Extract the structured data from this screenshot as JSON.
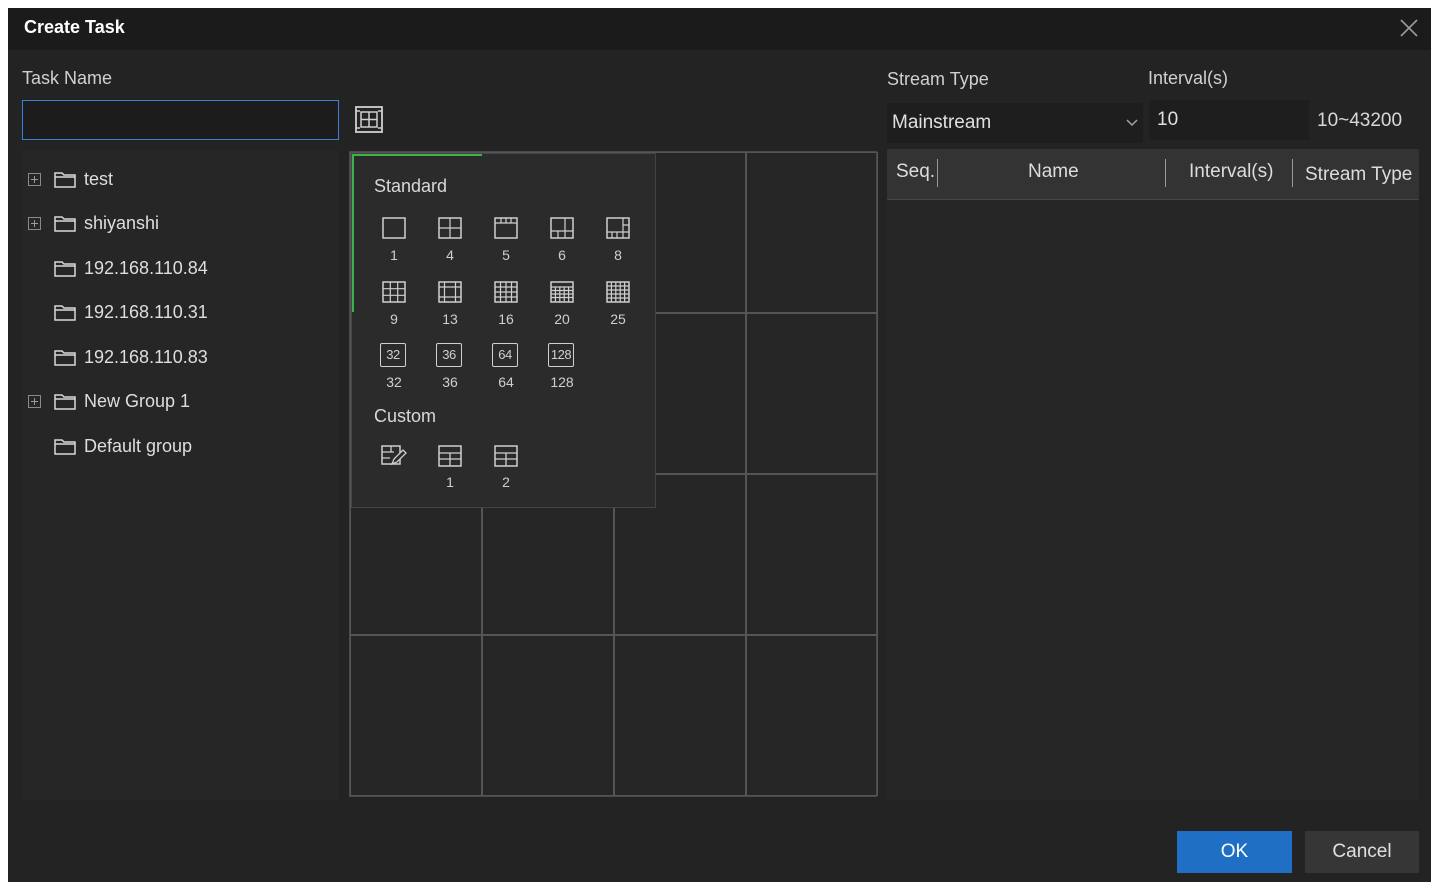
{
  "window": {
    "title": "Create Task"
  },
  "left": {
    "task_name_label": "Task Name",
    "task_name_value": "",
    "tree": [
      {
        "label": "test",
        "expandable": true
      },
      {
        "label": "shiyanshi",
        "expandable": true
      },
      {
        "label": "192.168.110.84",
        "expandable": false
      },
      {
        "label": "192.168.110.31",
        "expandable": false
      },
      {
        "label": "192.168.110.83",
        "expandable": false
      },
      {
        "label": "New Group 1",
        "expandable": true
      },
      {
        "label": "Default group",
        "expandable": false
      }
    ]
  },
  "layout_popup": {
    "standard_heading": "Standard",
    "standard_options": [
      "1",
      "4",
      "5",
      "6",
      "8",
      "9",
      "13",
      "16",
      "20",
      "25",
      "32",
      "36",
      "64",
      "128"
    ],
    "custom_heading": "Custom",
    "custom_options": [
      "1",
      "2"
    ]
  },
  "right": {
    "stream_type_label": "Stream Type",
    "stream_type_value": "Mainstream",
    "interval_label": "Interval(s)",
    "interval_value": "10",
    "interval_range": "10~43200",
    "columns": [
      "Seq.",
      "Name",
      "Interval(s)",
      "Stream Type"
    ]
  },
  "buttons": {
    "ok": "OK",
    "cancel": "Cancel"
  },
  "colors": {
    "accent": "#1f6fc4",
    "selection": "#3cb34a",
    "input_focus": "#3a7fd5"
  }
}
